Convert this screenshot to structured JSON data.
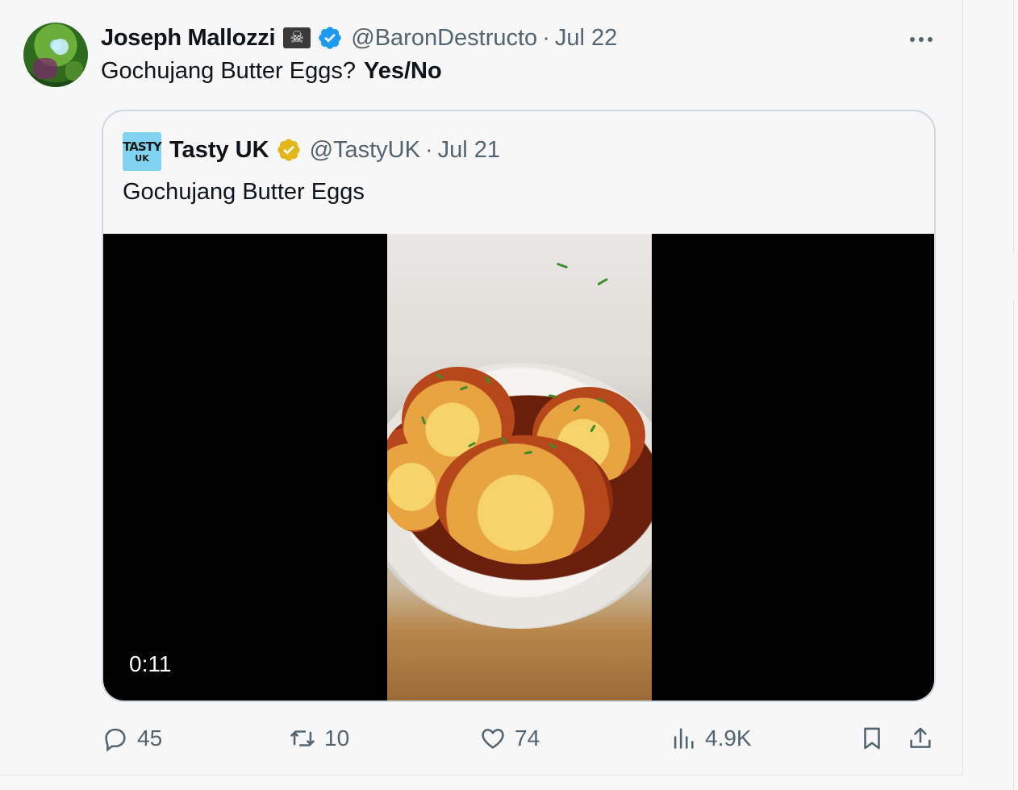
{
  "tweet": {
    "author_name": "Joseph Mallozzi",
    "badge_emoji": "☠",
    "handle": "@BaronDestructo",
    "separator": "·",
    "date": "Jul 22",
    "text": "Gochujang Butter Eggs?",
    "text_bold": "Yes/No"
  },
  "quote": {
    "avatar_line1": "TASTY",
    "avatar_line2": "UK",
    "author_name": "Tasty UK",
    "handle": "@TastyUK",
    "separator": "·",
    "date": "Jul 21",
    "text": "Gochujang Butter Eggs",
    "video_duration": "0:11"
  },
  "actions": {
    "replies": "45",
    "retweets": "10",
    "likes": "74",
    "views": "4.9K"
  },
  "icons": {
    "more": "more-icon",
    "reply": "reply-icon",
    "retweet": "retweet-icon",
    "like": "heart-icon",
    "views": "views-icon",
    "bookmark": "bookmark-icon",
    "share": "share-icon",
    "verified": "verified-badge-icon",
    "gold_verified": "gold-verified-badge-icon"
  },
  "colors": {
    "background": "#f7f7f7",
    "text_primary": "#0f1419",
    "text_secondary": "#536471",
    "verified_blue": "#1d9bf0",
    "verified_gold": "#e2b719",
    "border": "#cfd9de"
  }
}
